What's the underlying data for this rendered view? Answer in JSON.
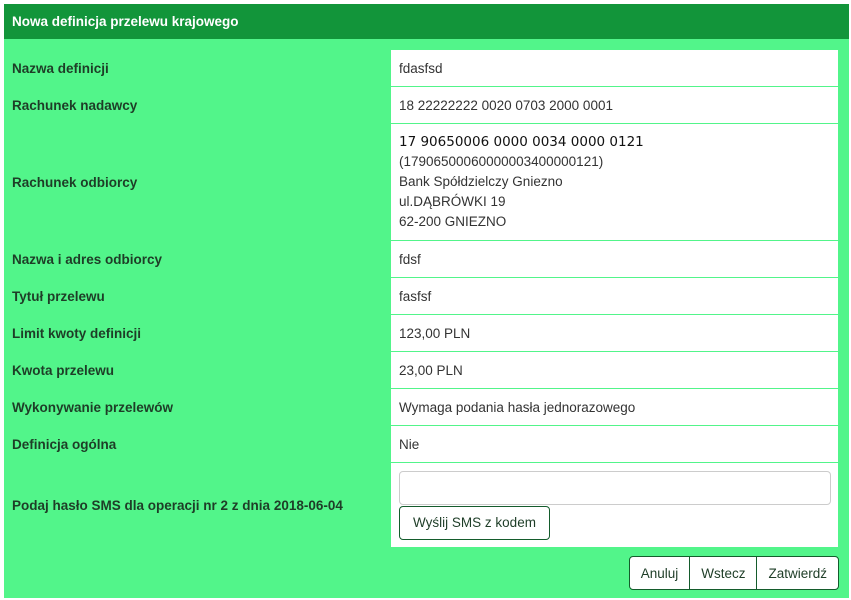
{
  "header": {
    "title": "Nowa definicja przelewu krajowego"
  },
  "rows": [
    {
      "label": "Nazwa definicji",
      "value": "fdasfsd"
    },
    {
      "label": "Rachunek nadawcy",
      "value": "18 22222222 0020 0703 2000 0001"
    },
    {
      "label": "Rachunek odbiorcy",
      "account_formatted": "17 90650006 0000 0034 0000 0121",
      "account_raw": "(17906500060000003400000121)",
      "bank_name": "Bank Spółdzielczy Gniezno",
      "bank_street": "ul.DĄBRÓWKI 19",
      "bank_city": "62-200 GNIEZNO"
    },
    {
      "label": "Nazwa i adres odbiorcy",
      "value": "fdsf"
    },
    {
      "label": "Tytuł przelewu",
      "value": "fasfsf"
    },
    {
      "label": "Limit kwoty definicji",
      "value": "123,00 PLN"
    },
    {
      "label": "Kwota przelewu",
      "value": "23,00 PLN"
    },
    {
      "label": "Wykonywanie przelewów",
      "value": "Wymaga podania hasła jednorazowego"
    },
    {
      "label": "Definicja ogólna",
      "value": "Nie"
    },
    {
      "label": "Podaj hasło SMS dla operacji nr 2 z dnia 2018-06-04",
      "input_value": "",
      "button_label": "Wyślij SMS z kodem"
    }
  ],
  "footer": {
    "cancel_label": "Anuluj",
    "back_label": "Wstecz",
    "confirm_label": "Zatwierdź"
  },
  "colors": {
    "panel_bg": "#52f58a",
    "header_bg": "#12953a",
    "border_dark": "#145c2c"
  }
}
